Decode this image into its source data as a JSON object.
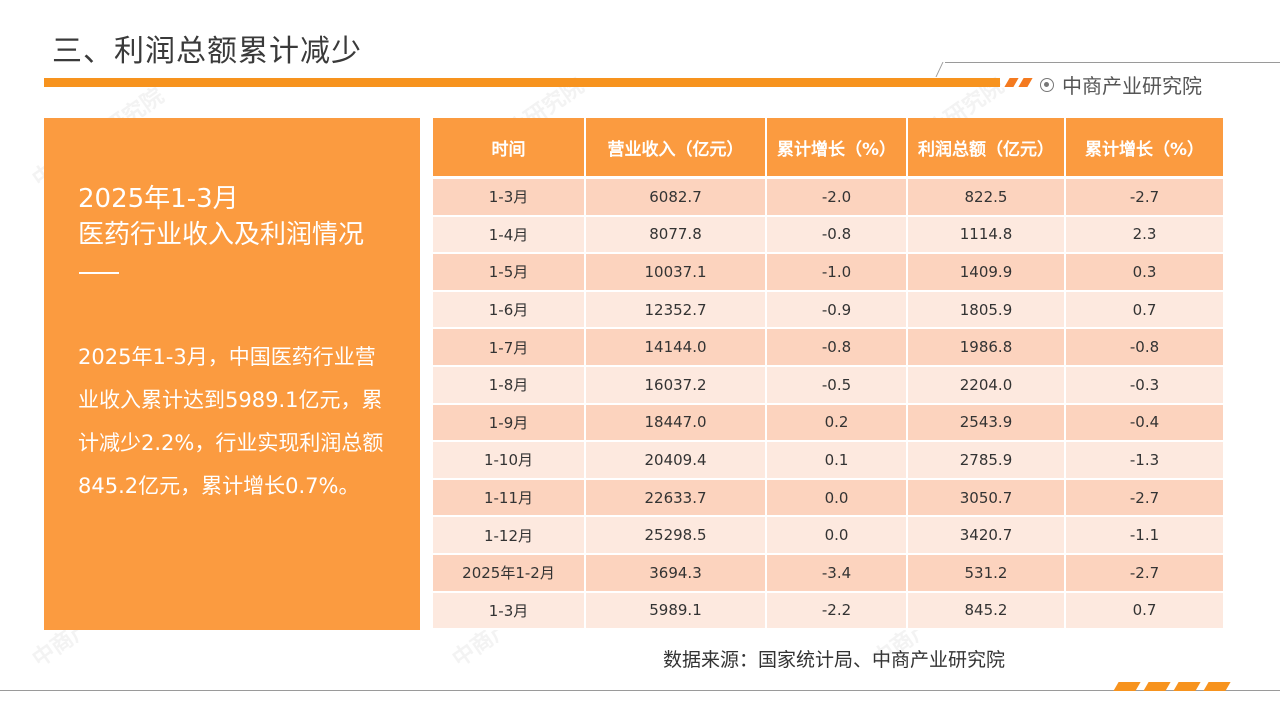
{
  "header": {
    "title": "三、利润总额累计减少",
    "brand": "中商产业研究院"
  },
  "panel": {
    "title_line1": "2025年1-3月",
    "title_line2": "医药行业收入及利润情况",
    "body": "2025年1-3月，中国医药行业营业收入累计达到5989.1亿元，累计减少2.2%，行业实现利润总额845.2亿元，累计增长0.7%。"
  },
  "table": {
    "headers": [
      "时间",
      "营业收入（亿元）",
      "累计增长（%）",
      "利润总额（亿元）",
      "累计增长（%）"
    ],
    "rows": [
      [
        "1-3月",
        "6082.7",
        "-2.0",
        "822.5",
        "-2.7"
      ],
      [
        "1-4月",
        "8077.8",
        "-0.8",
        "1114.8",
        "2.3"
      ],
      [
        "1-5月",
        "10037.1",
        "-1.0",
        "1409.9",
        "0.3"
      ],
      [
        "1-6月",
        "12352.7",
        "-0.9",
        "1805.9",
        "0.7"
      ],
      [
        "1-7月",
        "14144.0",
        "-0.8",
        "1986.8",
        "-0.8"
      ],
      [
        "1-8月",
        "16037.2",
        "-0.5",
        "2204.0",
        "-0.3"
      ],
      [
        "1-9月",
        "18447.0",
        "0.2",
        "2543.9",
        "-0.4"
      ],
      [
        "1-10月",
        "20409.4",
        "0.1",
        "2785.9",
        "-1.3"
      ],
      [
        "1-11月",
        "22633.7",
        "0.0",
        "3050.7",
        "-2.7"
      ],
      [
        "1-12月",
        "25298.5",
        "0.0",
        "3420.7",
        "-1.1"
      ],
      [
        "2025年1-2月",
        "3694.3",
        "-3.4",
        "531.2",
        "-2.7"
      ],
      [
        "1-3月",
        "5989.1",
        "-2.2",
        "845.2",
        "0.7"
      ]
    ]
  },
  "footer": {
    "source": "数据来源：国家统计局、中商产业研究院"
  },
  "colors": {
    "accent": "#f7931e",
    "panel": "#fb9b40",
    "row_dark": "#fcd3be",
    "row_light": "#fde9df"
  }
}
